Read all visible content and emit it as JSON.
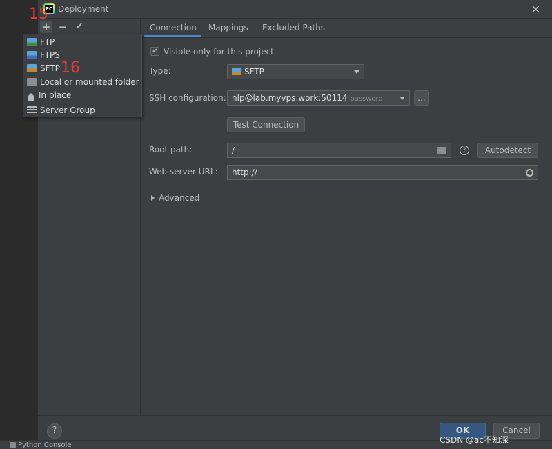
{
  "window": {
    "title": "Deployment",
    "app_icon": "pycharm-icon"
  },
  "toolbar": {
    "add_icon": "plus-icon",
    "remove_icon": "minus-icon",
    "confirm_icon": "check-icon"
  },
  "annotations": {
    "step_15": "15",
    "step_16": "16"
  },
  "add_menu": {
    "items": [
      {
        "label": "FTP",
        "icon": "ftp-icon"
      },
      {
        "label": "FTPS",
        "icon": "ftps-icon"
      },
      {
        "label": "SFTP",
        "icon": "sftp-icon"
      },
      {
        "label": "Local or mounted folder",
        "icon": "folder-icon"
      },
      {
        "label": "In place",
        "icon": "home-icon"
      },
      {
        "label": "Server Group",
        "icon": "server-group-icon"
      }
    ]
  },
  "tabs": [
    {
      "label": "Connection",
      "active": true
    },
    {
      "label": "Mappings",
      "active": false
    },
    {
      "label": "Excluded Paths",
      "active": false
    }
  ],
  "connection": {
    "visible_only_label": "Visible only for this project",
    "visible_only_checked": true,
    "type_label": "Type:",
    "type_value": "SFTP",
    "ssh_label": "SSH configuration:",
    "ssh_value": "nlp@lab.myvps.work:50114",
    "ssh_auth": "password",
    "ssh_more": "...",
    "test_button": "Test Connection",
    "root_label": "Root path:",
    "root_value": "/",
    "autodetect_button": "Autodetect",
    "web_label": "Web server URL:",
    "web_value": "http://",
    "advanced_label": "Advanced"
  },
  "footer": {
    "help": "?",
    "ok": "OK",
    "cancel": "Cancel"
  },
  "statusbar": {
    "python_console": "Python Console"
  },
  "watermark": "CSDN @ac不知深",
  "colors": {
    "accent": "#4a88c7",
    "ok_button": "#365880",
    "annotation": "#e83a3a"
  }
}
